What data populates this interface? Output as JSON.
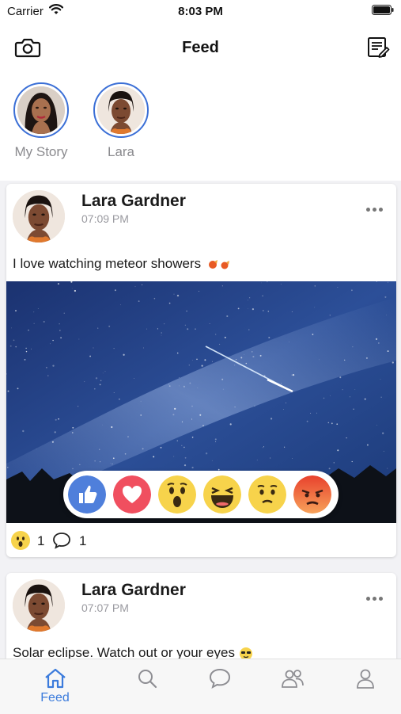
{
  "status_bar": {
    "carrier": "Carrier",
    "time": "8:03 PM"
  },
  "nav": {
    "title": "Feed",
    "left_icon": "camera-icon",
    "right_icon": "compose-icon"
  },
  "stories": [
    {
      "label": "My Story"
    },
    {
      "label": "Lara"
    }
  ],
  "posts": [
    {
      "author": "Lara Gardner",
      "time": "07:09 PM",
      "text": "I love watching meteor showers",
      "reactions_picker": [
        "like",
        "love",
        "wow",
        "haha",
        "sad",
        "angry"
      ],
      "reaction_summary": {
        "icon": "wow",
        "count": "1"
      },
      "comment_count": "1"
    },
    {
      "author": "Lara Gardner",
      "time": "07:07 PM",
      "text": "Solar eclipse. Watch out or your eyes"
    }
  ],
  "tabbar": {
    "items": [
      {
        "icon": "home-icon",
        "label": "Feed",
        "active": true
      },
      {
        "icon": "search-icon",
        "label": ""
      },
      {
        "icon": "chat-bubble-icon",
        "label": ""
      },
      {
        "icon": "friends-icon",
        "label": ""
      },
      {
        "icon": "profile-icon",
        "label": ""
      }
    ],
    "active_color": "#3b7bdc",
    "inactive_color": "#8e8e93"
  },
  "colors": {
    "accent": "#3b6fd6"
  }
}
